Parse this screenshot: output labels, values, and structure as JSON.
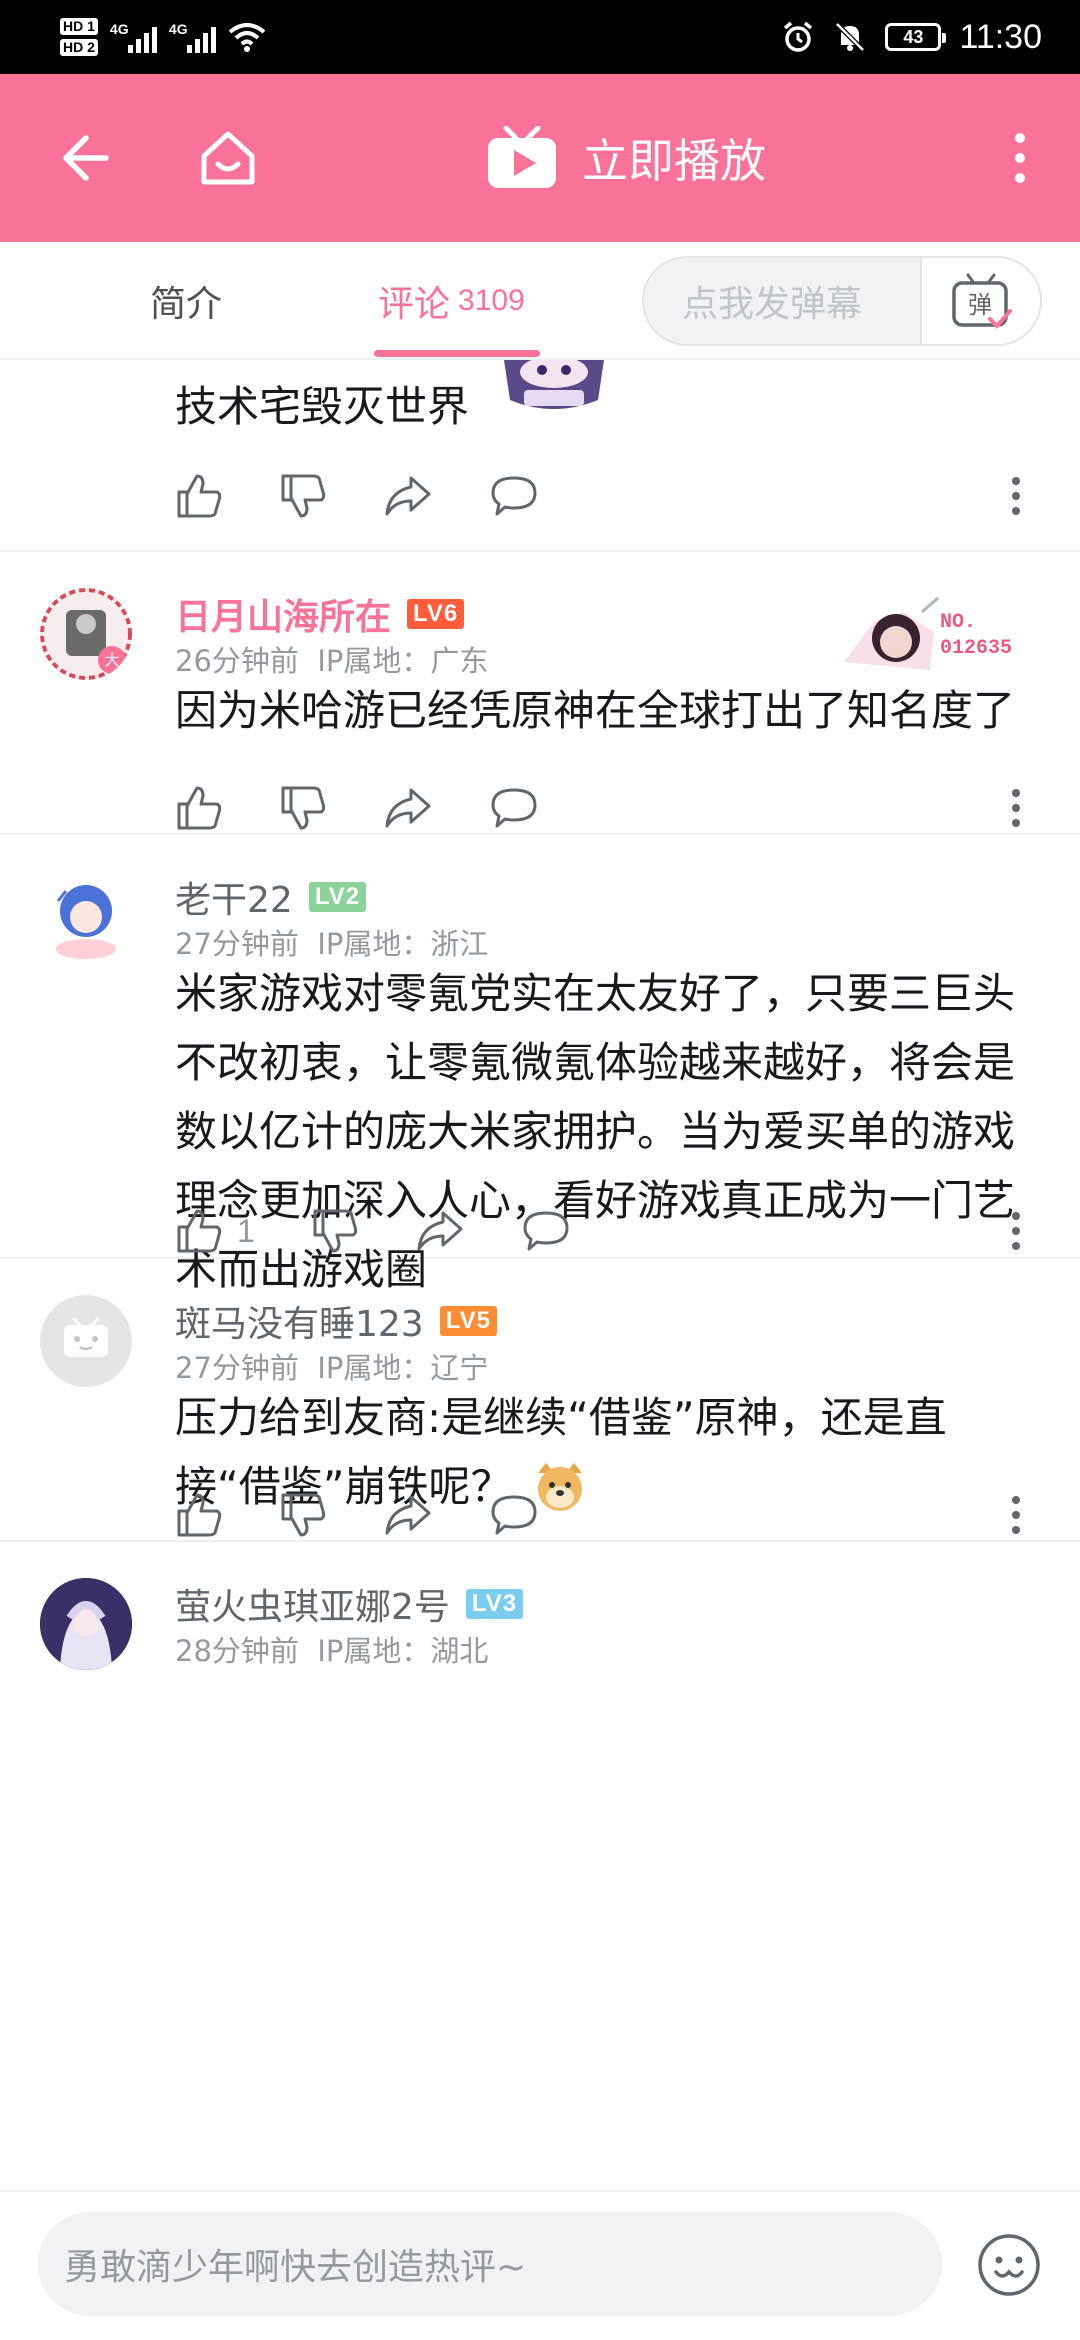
{
  "status_bar": {
    "hd1": "HD 1",
    "hd2": "HD 2",
    "net1": "4G",
    "net2": "4G",
    "battery": "43",
    "time": "11:30"
  },
  "header": {
    "title": "立即播放",
    "accent": "#fb7299"
  },
  "tabs": {
    "intro": "简介",
    "comments": "评论",
    "comment_count": "3109",
    "danmaku_placeholder": "点我发弹幕",
    "danmaku_icon_char": "弹"
  },
  "comments": [
    {
      "content": "技术宅毁灭世界",
      "likes": ""
    },
    {
      "username": "日月山海所在",
      "level": "LV6",
      "level_color": "#ff5c3b",
      "time": "26分钟前",
      "ip": "IP属地：广东",
      "avatar_badge": "大",
      "fan_badge_line1": "NO.",
      "fan_badge_line2": "012635",
      "content": "因为米哈游已经凭原神在全球打出了知名度了",
      "likes": ""
    },
    {
      "username": "老干22",
      "level": "LV2",
      "level_color": "#8bd29b",
      "time": "27分钟前",
      "ip": "IP属地：浙江",
      "content": "米家游戏对零氪党实在太友好了，只要三巨头不改初衷，让零氪微氪体验越来越好，将会是数以亿计的庞大米家拥护。当为爱买单的游戏理念更加深入人心，看好游戏真正成为一门艺术而出游戏圈",
      "likes": "1"
    },
    {
      "username": "斑马没有睡123",
      "level": "LV5",
      "level_color": "#ff8b33",
      "time": "27分钟前",
      "ip": "IP属地：辽宁",
      "content": "压力给到友商:是继续“借鉴”原神，还是直接“借鉴”崩铁呢？",
      "likes": ""
    },
    {
      "username": "萤火虫琪亚娜2号",
      "level": "LV3",
      "level_color": "#7bcdef",
      "time": "28分钟前",
      "ip": "IP属地：湖北"
    }
  ],
  "reply_bar": {
    "placeholder": "勇敢滴少年啊快去创造热评~"
  }
}
